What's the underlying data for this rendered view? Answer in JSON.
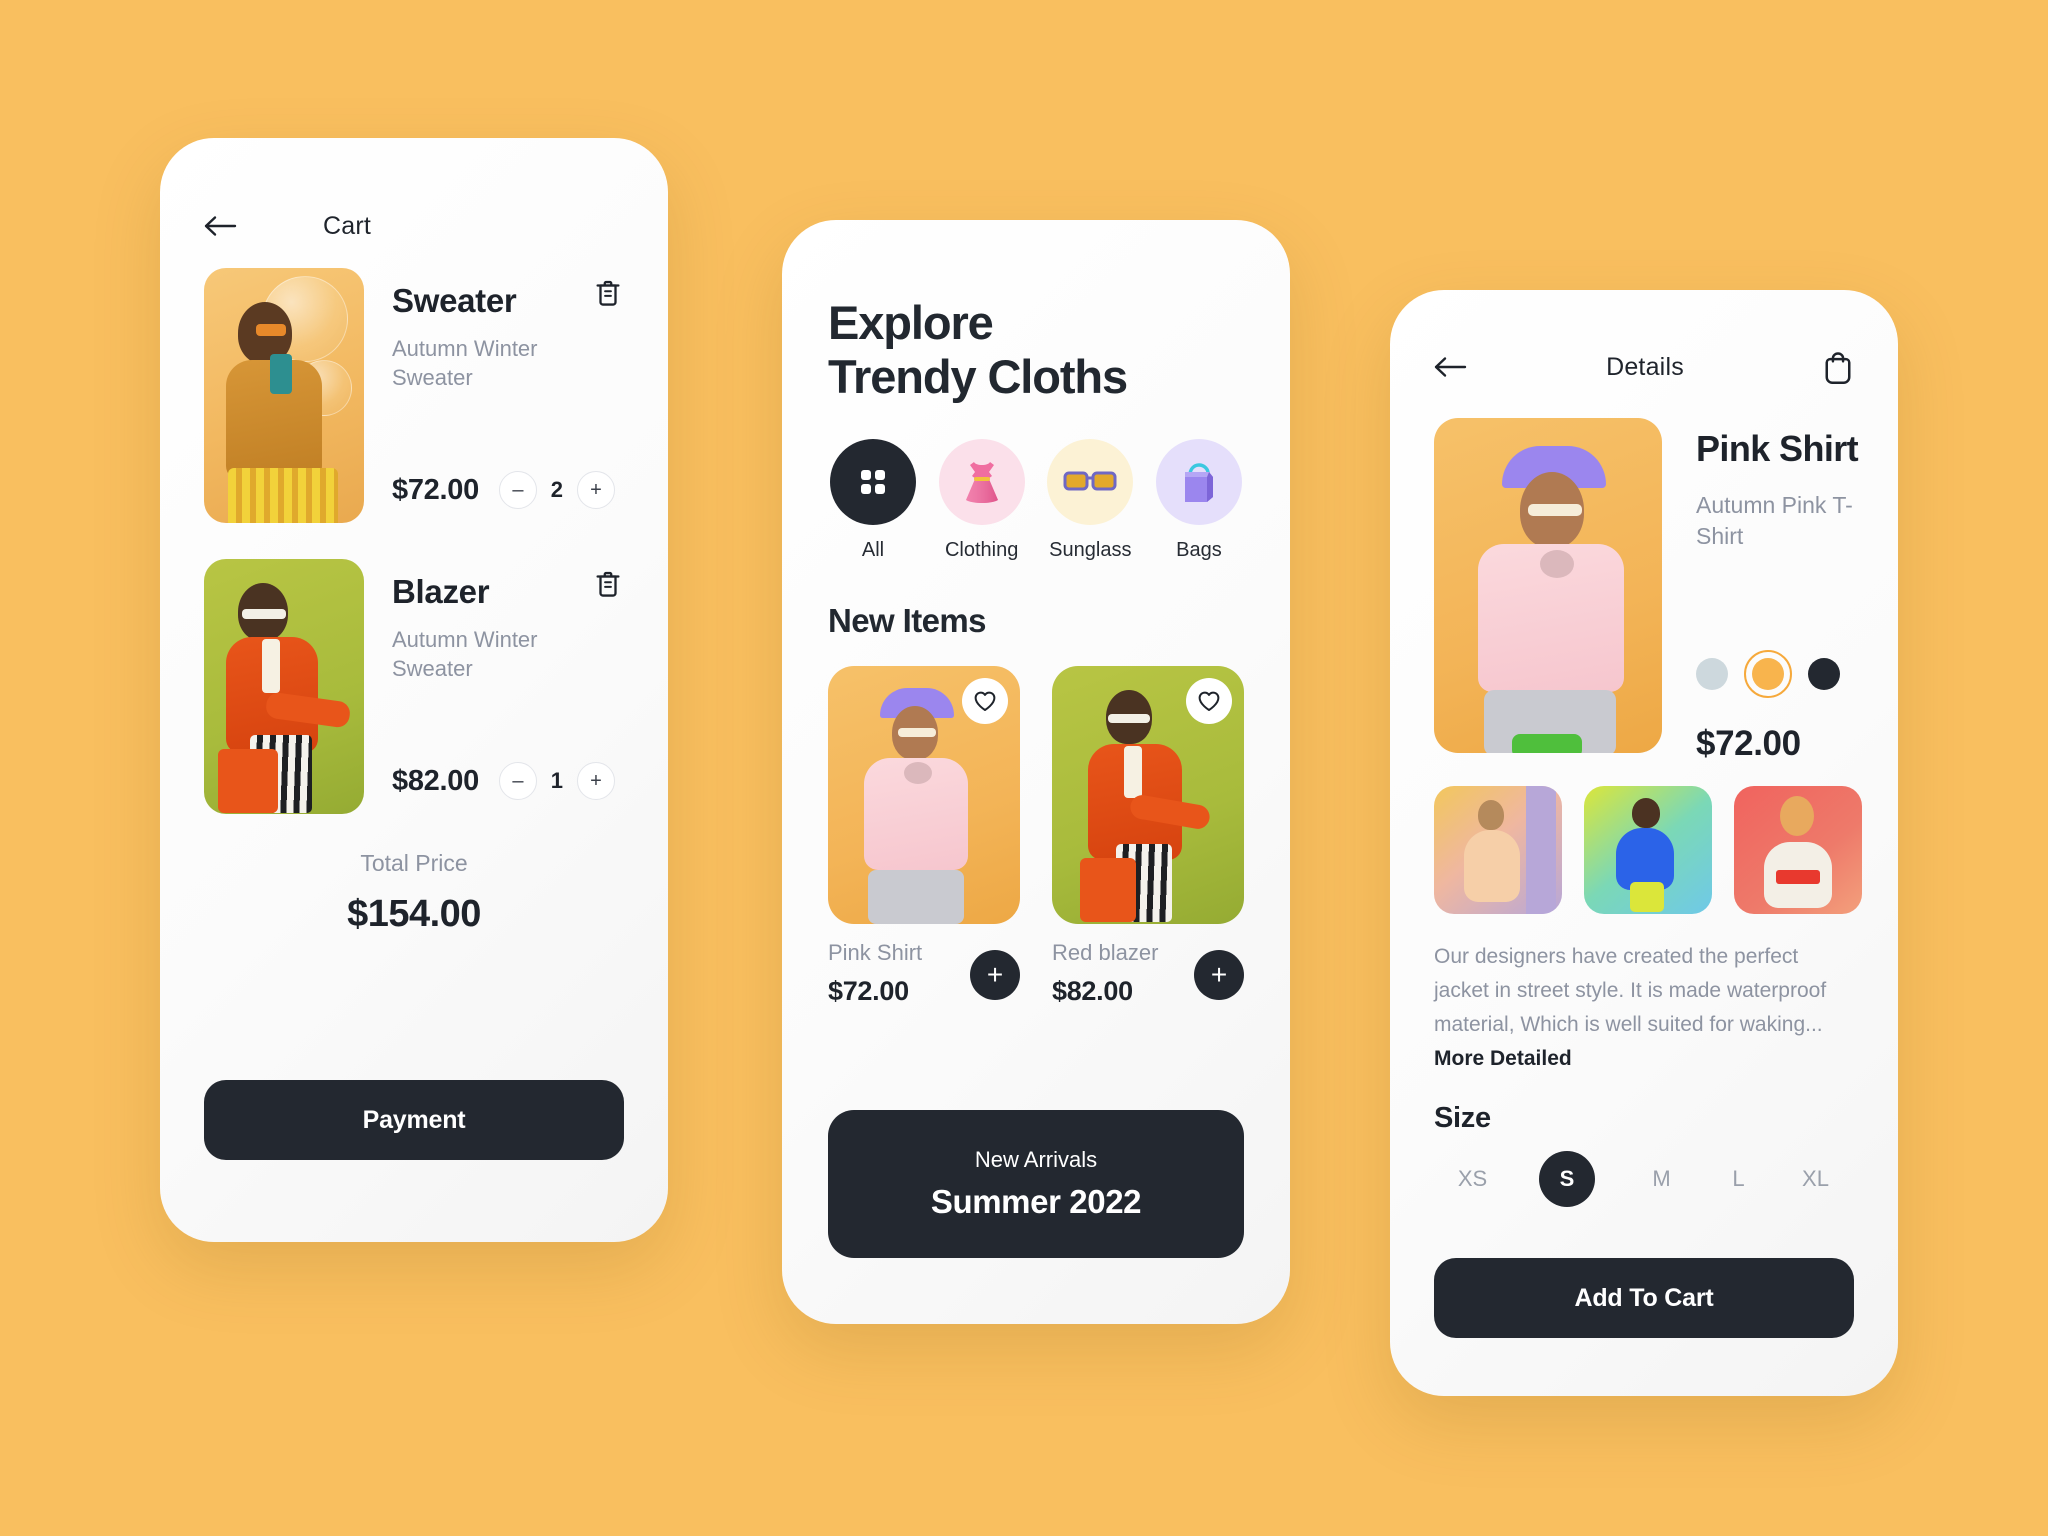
{
  "background_color": "#f9bf5f",
  "accent_dark": "#232830",
  "accent_orange": "#f6a93b",
  "cart_screen": {
    "back_icon": "arrow-left-icon",
    "title": "Cart",
    "items": [
      {
        "name": "Sweater",
        "subtitle": "Autumn Winter Sweater",
        "price": "$72.00",
        "quantity": "2",
        "minus_label": "–",
        "plus_label": "+",
        "delete_icon": "trash-icon"
      },
      {
        "name": "Blazer",
        "subtitle": "Autumn Winter Sweater",
        "price": "$82.00",
        "quantity": "1",
        "minus_label": "–",
        "plus_label": "+",
        "delete_icon": "trash-icon"
      }
    ],
    "total_label": "Total Price",
    "total_value": "$154.00",
    "payment_button": "Payment"
  },
  "explore_screen": {
    "title_line1": "Explore",
    "title_line2": "Trendy Cloths",
    "categories": [
      {
        "label": "All",
        "icon": "grid-icon",
        "circle_color": "#232830",
        "selected": true
      },
      {
        "label": "Clothing",
        "icon": "dress-icon",
        "circle_color": "#fbe0ea",
        "selected": false
      },
      {
        "label": "Sunglass",
        "icon": "sunglasses-icon",
        "circle_color": "#fcf2d5",
        "selected": false
      },
      {
        "label": "Bags",
        "icon": "bag-icon",
        "circle_color": "#e5dffb",
        "selected": false
      }
    ],
    "section_title": "New Items",
    "products": [
      {
        "name": "Pink Shirt",
        "price": "$72.00",
        "favorite_icon": "heart-icon",
        "add_label": "+"
      },
      {
        "name": "Red blazer",
        "price": "$82.00",
        "favorite_icon": "heart-icon",
        "add_label": "+"
      }
    ],
    "banner": {
      "small": "New Arrivals",
      "big": "Summer 2022"
    }
  },
  "details_screen": {
    "back_icon": "arrow-left-icon",
    "title": "Details",
    "bag_icon": "shopping-bag-icon",
    "product_name": "Pink Shirt",
    "product_subtitle": "Autumn Pink T-Shirt",
    "colors": [
      {
        "name": "light-gray",
        "hex": "#cdd8dd",
        "selected": false
      },
      {
        "name": "orange",
        "hex": "#f8b44d",
        "selected": true
      },
      {
        "name": "dark-navy",
        "hex": "#232830",
        "selected": false
      }
    ],
    "price": "$72.00",
    "gallery_count": 3,
    "description_text": "Our designers have created the perfect jacket in street style. It is made waterproof material, Which is well suited for waking...",
    "description_link": "More Detailed",
    "size_title": "Size",
    "sizes": [
      {
        "label": "XS",
        "selected": false
      },
      {
        "label": "S",
        "selected": true
      },
      {
        "label": "M",
        "selected": false
      },
      {
        "label": "L",
        "selected": false
      },
      {
        "label": "XL",
        "selected": false
      }
    ],
    "add_to_cart_button": "Add To Cart"
  }
}
